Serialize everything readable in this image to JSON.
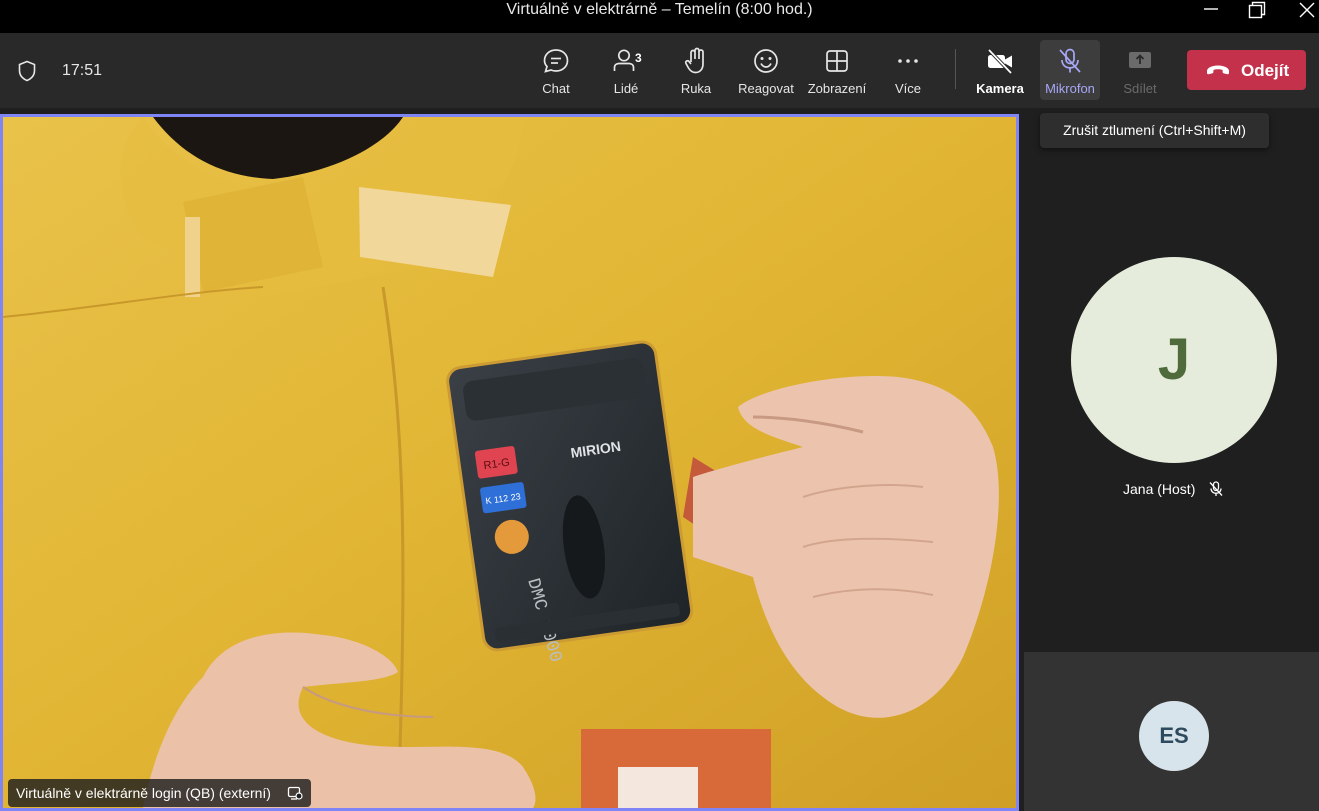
{
  "window": {
    "title": "Virtuálně v elektrárně – Temelín (8:00 hod.)"
  },
  "toolbar": {
    "time": "17:51",
    "chat_label": "Chat",
    "people_label": "Lidé",
    "people_count": "3",
    "raise_hand_label": "Ruka",
    "react_label": "Reagovat",
    "view_label": "Zobrazení",
    "more_label": "Více",
    "camera_label": "Kamera",
    "mic_label": "Mikrofon",
    "share_label": "Sdílet",
    "leave_label": "Odejít"
  },
  "tooltip": {
    "text": "Zrušit ztlumení (Ctrl+Shift+M)"
  },
  "stage": {
    "caption": "Virtuálně v elektrárně login (QB) (externí)",
    "device_text": [
      "MIRION",
      "R1-G",
      "K 112 23",
      "DMC 3000"
    ]
  },
  "participants": [
    {
      "initials": "J",
      "name": "Jana (Host)",
      "muted": true
    },
    {
      "initials": "ES"
    }
  ],
  "colors": {
    "accent": "#7f85f5",
    "leave": "#c4314b",
    "toolbar": "#292929"
  }
}
